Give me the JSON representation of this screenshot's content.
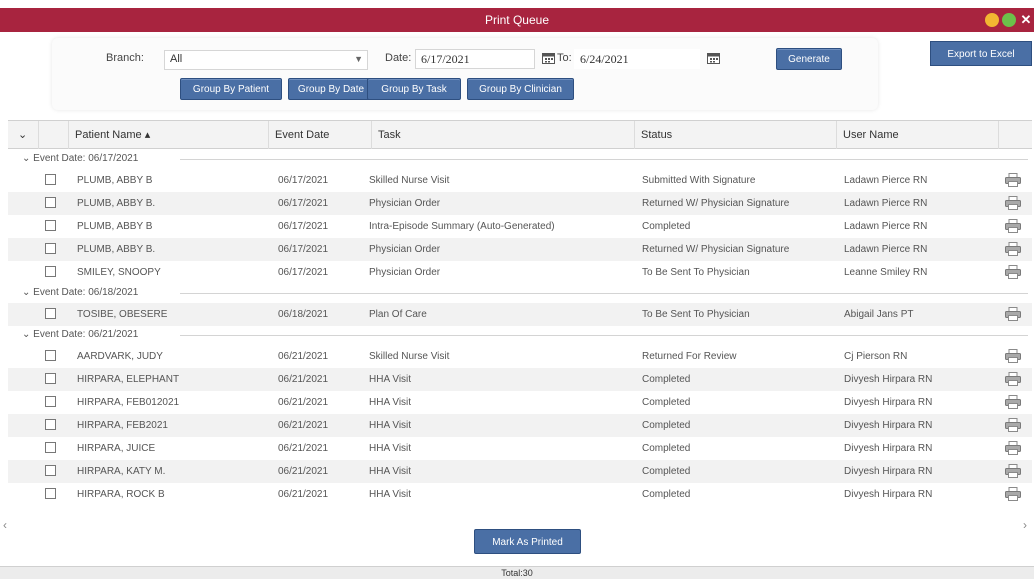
{
  "window": {
    "title": "Print Queue",
    "close_glyph": "✕"
  },
  "filters": {
    "branch_label": "Branch:",
    "branch_value": "All",
    "date_label": "Date:",
    "date_from": "6/17/2021",
    "to_label": "To:",
    "date_to": "6/24/2021",
    "generate_label": "Generate",
    "export_label": "Export to Excel",
    "group_buttons": [
      "Group By Patient",
      "Group By Date",
      "Group By Task",
      "Group By Clinician"
    ]
  },
  "table": {
    "columns": [
      "Patient Name ▴",
      "Event Date",
      "Task",
      "Status",
      "User Name"
    ],
    "groups": [
      {
        "label": "Event Date: 06/17/2021",
        "rows": [
          [
            "PLUMB, ABBY B",
            "06/17/2021",
            "Skilled Nurse Visit",
            "Submitted With Signature",
            "Ladawn Pierce RN"
          ],
          [
            "PLUMB, ABBY B.",
            "06/17/2021",
            "Physician Order",
            "Returned W/ Physician Signature",
            "Ladawn Pierce RN"
          ],
          [
            "PLUMB, ABBY B",
            "06/17/2021",
            "Intra-Episode Summary (Auto-Generated)",
            "Completed",
            "Ladawn Pierce RN"
          ],
          [
            "PLUMB, ABBY B.",
            "06/17/2021",
            "Physician Order",
            "Returned W/ Physician Signature",
            "Ladawn Pierce RN"
          ],
          [
            "SMILEY, SNOOPY",
            "06/17/2021",
            "Physician Order",
            "To Be Sent To Physician",
            "Leanne Smiley RN"
          ]
        ]
      },
      {
        "label": "Event Date: 06/18/2021",
        "rows": [
          [
            "TOSIBE, OBESERE",
            "06/18/2021",
            "Plan Of Care",
            "To Be Sent To Physician",
            "Abigail Jans PT"
          ]
        ]
      },
      {
        "label": "Event Date: 06/21/2021",
        "rows": [
          [
            "AARDVARK, JUDY",
            "06/21/2021",
            "Skilled Nurse Visit",
            "Returned For Review",
            "Cj Pierson RN"
          ],
          [
            "HIRPARA, ELEPHANT",
            "06/21/2021",
            "HHA Visit",
            "Completed",
            "Divyesh Hirpara RN"
          ],
          [
            "HIRPARA, FEB012021",
            "06/21/2021",
            "HHA Visit",
            "Completed",
            "Divyesh Hirpara RN"
          ],
          [
            "HIRPARA, FEB2021",
            "06/21/2021",
            "HHA Visit",
            "Completed",
            "Divyesh Hirpara RN"
          ],
          [
            "HIRPARA, JUICE",
            "06/21/2021",
            "HHA Visit",
            "Completed",
            "Divyesh Hirpara RN"
          ],
          [
            "HIRPARA, KATY M.",
            "06/21/2021",
            "HHA Visit",
            "Completed",
            "Divyesh Hirpara RN"
          ],
          [
            "HIRPARA, ROCK B",
            "06/21/2021",
            "HHA Visit",
            "Completed",
            "Divyesh Hirpara RN"
          ]
        ]
      }
    ]
  },
  "actions": {
    "mark_printed_label": "Mark As Printed"
  },
  "footer": {
    "total": "Total:30"
  },
  "colors": {
    "titlebar": "#a8243f",
    "button": "#4a6fa5"
  }
}
